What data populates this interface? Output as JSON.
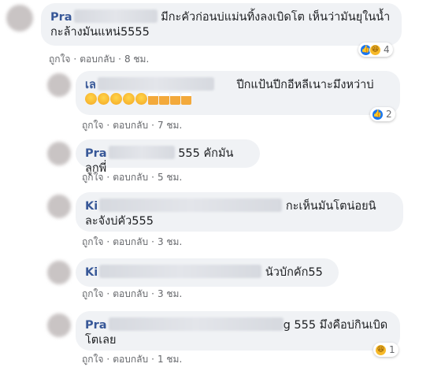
{
  "comments": [
    {
      "name": "Pra",
      "text": "มีกะคัวก่อนบ่แม่นทิ้งลงเบิดโต เห็นว่ามันยุในน้ำ",
      "text2": "กะล้างมันแหน่5555",
      "like": "ถูกใจ",
      "reply": "ตอบกลับ",
      "time": "8 ชม.",
      "reaction_count": "4"
    },
    {
      "name": "เล",
      "text": "ปีกแป้นปีกอีหลีเนาะมึงหว่าบ่",
      "like": "ถูกใจ",
      "reply": "ตอบกลับ",
      "time": "7 ชม.",
      "reaction_count": "2"
    },
    {
      "name": "Pra",
      "text": "555 คักมันลูกพี่",
      "like": "ถูกใจ",
      "reply": "ตอบกลับ",
      "time": "5 ชม."
    },
    {
      "name": "Ki",
      "text": "กะเห็นมันโตน่อยนิ",
      "text2": "ละจังบ่คัว555",
      "like": "ถูกใจ",
      "reply": "ตอบกลับ",
      "time": "3 ชม."
    },
    {
      "name": "Ki",
      "text": "นัวบักคัก55",
      "like": "ถูกใจ",
      "reply": "ตอบกลับ",
      "time": "3 ชม."
    },
    {
      "name": "Pra",
      "text": "g 555 มึงคือบ่กินเบิด",
      "text2": "โตเลย",
      "like": "ถูกใจ",
      "reply": "ตอบกลับ",
      "time": "1 ชม.",
      "reaction_count": "1"
    }
  ],
  "separator": "·",
  "colors": {
    "link": "#385898",
    "bubble": "#f0f2f5",
    "meta": "#65676b",
    "like": "#1877f2",
    "haha": "#f7b928"
  }
}
